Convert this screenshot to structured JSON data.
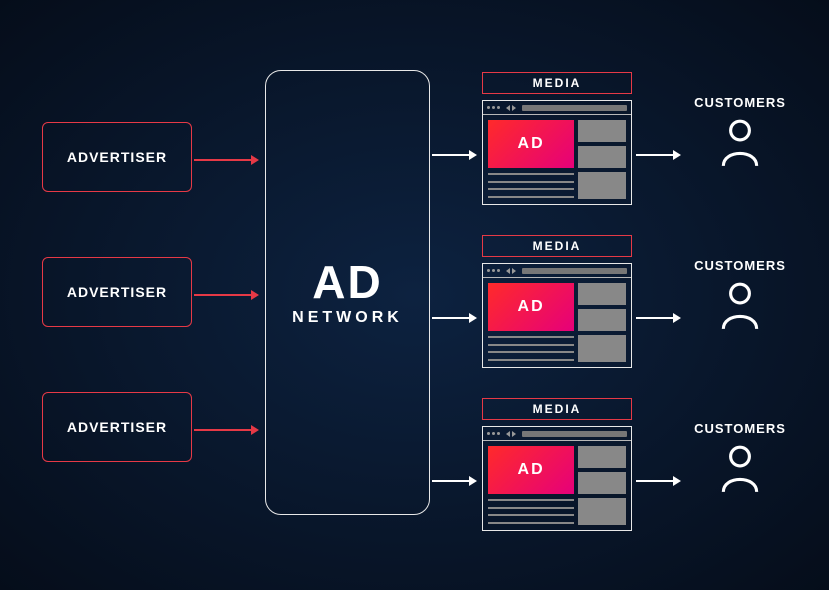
{
  "advertisers": [
    {
      "label": "ADVERTISER"
    },
    {
      "label": "ADVERTISER"
    },
    {
      "label": "ADVERTISER"
    }
  ],
  "ad_network": {
    "title": "AD",
    "subtitle": "NETWORK"
  },
  "media": [
    {
      "label": "MEDIA",
      "ad_label": "AD"
    },
    {
      "label": "MEDIA",
      "ad_label": "AD"
    },
    {
      "label": "MEDIA",
      "ad_label": "AD"
    }
  ],
  "customers": [
    {
      "label": "CUSTOMERS"
    },
    {
      "label": "CUSTOMERS"
    },
    {
      "label": "CUSTOMERS"
    }
  ]
}
